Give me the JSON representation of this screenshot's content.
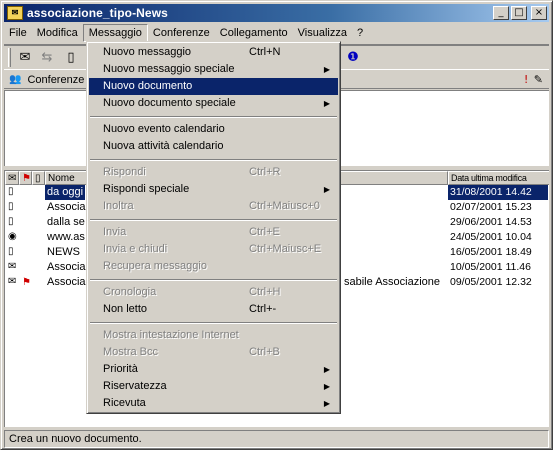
{
  "window": {
    "title": "associazione_tipo-News",
    "app_icon": "notes-icon"
  },
  "title_buttons": {
    "minimize": "_",
    "maximize": "□",
    "close": "×"
  },
  "menubar": [
    "File",
    "Modifica",
    "Messaggio",
    "Conferenze",
    "Collegamento",
    "Visualizza",
    "?"
  ],
  "conference_bar": {
    "label": "Conferenze"
  },
  "list": {
    "headers": {
      "name": "Nome",
      "date": "Data ultima modifica"
    },
    "rows": [
      {
        "icon": "document-icon",
        "name": "da oggi",
        "from": "",
        "date": "31/08/2001 14.42",
        "selected": true
      },
      {
        "icon": "document-icon",
        "name": "Associa",
        "from": "",
        "date": "02/07/2001 15.23"
      },
      {
        "icon": "document-icon",
        "name": "dalla se",
        "from": "",
        "date": "29/06/2001 14.53"
      },
      {
        "icon": "web-icon",
        "name": "www.as",
        "from": "",
        "date": "24/05/2001 10.04"
      },
      {
        "icon": "document-icon",
        "name": "NEWS",
        "from": "",
        "date": "16/05/2001 18.49"
      },
      {
        "icon": "envelope-icon",
        "name": "Associaz",
        "from": "",
        "date": "10/05/2001 11.46"
      },
      {
        "icon": "envelope-icon",
        "name": "Associaz",
        "from": "sabile Associazione",
        "date": "09/05/2001 12.32",
        "flag": true
      }
    ]
  },
  "dropdown": {
    "items": [
      {
        "label": "Nuovo messaggio",
        "shortcut": "Ctrl+N",
        "sub": false,
        "disabled": false
      },
      {
        "label": "Nuovo messaggio speciale",
        "shortcut": "",
        "sub": true,
        "disabled": false
      },
      {
        "label": "Nuovo documento",
        "shortcut": "",
        "sub": false,
        "disabled": false,
        "highlighted": true
      },
      {
        "label": "Nuovo documento speciale",
        "shortcut": "",
        "sub": true,
        "disabled": false
      },
      {
        "sep": true
      },
      {
        "label": "Nuovo evento calendario",
        "shortcut": "",
        "sub": false,
        "disabled": false
      },
      {
        "label": "Nuova attività calendario",
        "shortcut": "",
        "sub": false,
        "disabled": false
      },
      {
        "sep": true
      },
      {
        "label": "Rispondi",
        "shortcut": "Ctrl+R",
        "sub": false,
        "disabled": true
      },
      {
        "label": "Rispondi speciale",
        "shortcut": "",
        "sub": true,
        "disabled": false
      },
      {
        "label": "Inoltra",
        "shortcut": "Ctrl+Maiusc+0",
        "sub": false,
        "disabled": true
      },
      {
        "sep": true
      },
      {
        "label": "Invia",
        "shortcut": "Ctrl+E",
        "sub": false,
        "disabled": true
      },
      {
        "label": "Invia e chiudi",
        "shortcut": "Ctrl+Maiusc+E",
        "sub": false,
        "disabled": true
      },
      {
        "label": "Recupera messaggio",
        "shortcut": "",
        "sub": false,
        "disabled": true
      },
      {
        "sep": true
      },
      {
        "label": "Cronologia",
        "shortcut": "Ctrl+H",
        "sub": false,
        "disabled": true
      },
      {
        "label": "Non letto",
        "shortcut": "Ctrl+-",
        "sub": false,
        "disabled": false
      },
      {
        "sep": true
      },
      {
        "label": "Mostra intestazione Internet",
        "shortcut": "",
        "sub": false,
        "disabled": true
      },
      {
        "label": "Mostra Bcc",
        "shortcut": "Ctrl+B",
        "sub": false,
        "disabled": true
      },
      {
        "label": "Priorità",
        "shortcut": "",
        "sub": true,
        "disabled": false
      },
      {
        "label": "Riservatezza",
        "shortcut": "",
        "sub": true,
        "disabled": false
      },
      {
        "label": "Ricevuta",
        "shortcut": "",
        "sub": true,
        "disabled": false
      }
    ]
  },
  "status": {
    "text": "Crea un nuovo documento."
  }
}
